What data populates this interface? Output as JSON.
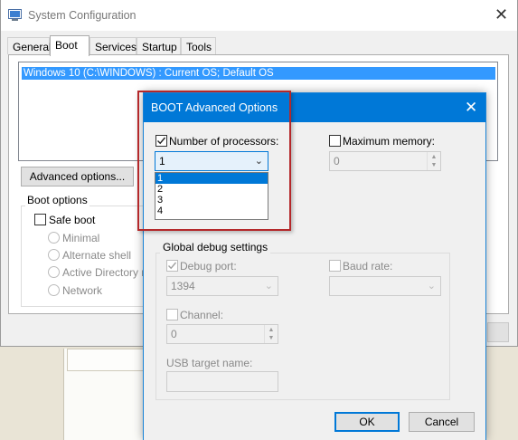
{
  "main_window": {
    "title": "System Configuration",
    "tabs": [
      "General",
      "Boot",
      "Services",
      "Startup",
      "Tools"
    ],
    "active_tab": "Boot",
    "os_list": [
      "Windows 10 (C:\\WINDOWS) : Current OS; Default OS"
    ],
    "advanced_button": "Advanced options...",
    "boot_options_label": "Boot options",
    "safe_boot_label": "Safe boot",
    "safe_boot_modes": [
      "Minimal",
      "Alternate shell",
      "Active Directory rep",
      "Network"
    ]
  },
  "dialog": {
    "title": "BOOT Advanced Options",
    "num_processors_label": "Number of processors:",
    "num_processors_checked": true,
    "num_processors_value": "1",
    "processor_options": [
      "1",
      "2",
      "3",
      "4"
    ],
    "processor_highlighted": "1",
    "max_memory_label": "Maximum memory:",
    "max_memory_checked": false,
    "max_memory_value": "0",
    "debug_group_label": "Global debug settings",
    "debug_port_label": "Debug port:",
    "debug_port_checked": true,
    "debug_port_value": "1394",
    "baud_rate_label": "Baud rate:",
    "baud_rate_value": "",
    "channel_label": "Channel:",
    "channel_value": "0",
    "usb_target_label": "USB target name:",
    "usb_target_value": "",
    "ok_label": "OK",
    "cancel_label": "Cancel"
  },
  "colors": {
    "dialog_titlebar": "#0078d7",
    "selection": "#3399ff",
    "highlight_box": "#b4282a"
  }
}
